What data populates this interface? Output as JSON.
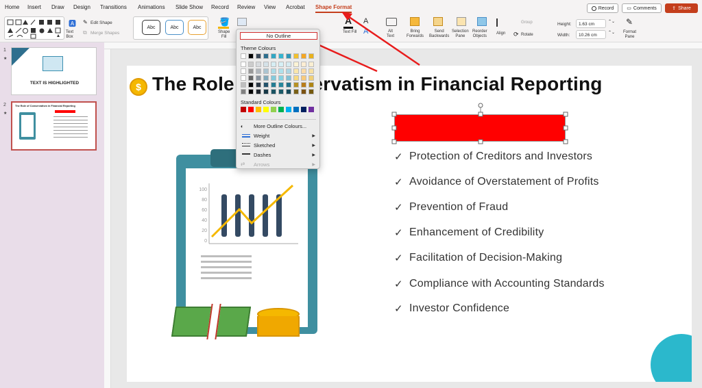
{
  "tabs": [
    "Home",
    "Insert",
    "Draw",
    "Design",
    "Transitions",
    "Animations",
    "Slide Show",
    "Record",
    "Review",
    "View",
    "Acrobat",
    "Shape Format"
  ],
  "active_tab": "Shape Format",
  "topbar": {
    "record": "Record",
    "comments": "Comments",
    "share": "Share"
  },
  "ribbon": {
    "text_box": "Text\nBox",
    "edit_shape": "Edit Shape",
    "merge_shapes": "Merge Shapes",
    "style1": "Abc",
    "style2": "Abc",
    "style3": "Abc",
    "shape_fill": "Shape\nFill",
    "text_fill": "Text Fill",
    "alt_text": "Alt\nText",
    "bring_forwards": "Bring\nForwards",
    "send_backwards": "Send\nBackwards",
    "selection_pane": "Selection\nPane",
    "reorder_objects": "Reorder\nObjects",
    "align": "Align",
    "group": "Group",
    "rotate": "Rotate",
    "height_label": "Height:",
    "height_value": "1.63 cm",
    "width_label": "Width:",
    "width_value": "10.26 cm",
    "format_pane": "Format\nPane"
  },
  "outline_menu": {
    "no_outline": "No Outline",
    "theme_colours": "Theme Colours",
    "standard_colours": "Standard Colours",
    "more_outline": "More Outline Colours...",
    "weight": "Weight",
    "sketched": "Sketched",
    "dashes": "Dashes",
    "arrows": "Arrows",
    "theme_top": [
      "#ffffff",
      "#000000",
      "#3b4a5a",
      "#2e6f8e",
      "#31a6c4",
      "#34b4d0",
      "#2e96b8",
      "#f2c12e",
      "#f5a623",
      "#e8b11c"
    ],
    "standard": [
      "#c00000",
      "#ff0000",
      "#ffc000",
      "#ffff00",
      "#92d050",
      "#00b050",
      "#00b0f0",
      "#0070c0",
      "#002060",
      "#7030a0"
    ]
  },
  "slides": [
    {
      "num": "1",
      "title": "TEXT IS HIGHLIGHTED"
    },
    {
      "num": "2",
      "title": "The Role of Conservatism in Financial Reporting"
    }
  ],
  "slide": {
    "title": "The Role of Conservatism in Financial Reporting",
    "bullets": [
      "Protection of Creditors and Investors",
      "Avoidance of Overstatement of Profits",
      "Prevention of Fraud",
      "Enhancement of Credibility",
      "Facilitation of Decision-Making",
      "Compliance with Accounting Standards",
      "Investor Confidence"
    ],
    "chart_ticks": [
      "100",
      "80",
      "60",
      "40",
      "20",
      "0"
    ]
  }
}
